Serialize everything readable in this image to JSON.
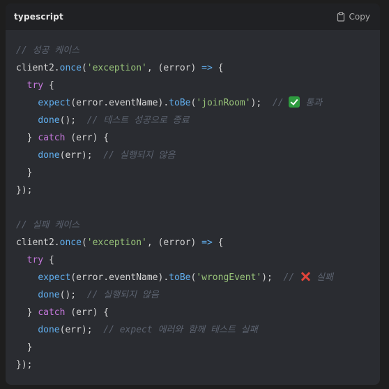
{
  "header": {
    "language": "typescript",
    "copy_label": "Copy",
    "copy_icon": "clipboard-icon"
  },
  "code": {
    "lines": [
      {
        "indent": "",
        "tokens": [
          [
            "cm",
            "// 성공 케이스"
          ]
        ]
      },
      {
        "indent": "",
        "tokens": [
          [
            "pl",
            "client2."
          ],
          [
            "fn",
            "once"
          ],
          [
            "pl",
            "("
          ],
          [
            "str",
            "'exception'"
          ],
          [
            "pl",
            ", (error) "
          ],
          [
            "fn",
            "=>"
          ],
          [
            "pl",
            " {"
          ]
        ]
      },
      {
        "indent": "  ",
        "tokens": [
          [
            "kw",
            "try"
          ],
          [
            "pl",
            " {"
          ]
        ]
      },
      {
        "indent": "    ",
        "tokens": [
          [
            "fn",
            "expect"
          ],
          [
            "pl",
            "(error.eventName)."
          ],
          [
            "fn",
            "toBe"
          ],
          [
            "pl",
            "("
          ],
          [
            "str",
            "'joinRoom'"
          ],
          [
            "pl",
            ");  "
          ],
          [
            "cm",
            "// "
          ],
          [
            "emoji",
            "check-mark-emoji"
          ],
          [
            "cm",
            " 통과"
          ]
        ]
      },
      {
        "indent": "    ",
        "tokens": [
          [
            "fn",
            "done"
          ],
          [
            "pl",
            "();  "
          ],
          [
            "cm",
            "// 테스트 성공으로 종료"
          ]
        ]
      },
      {
        "indent": "  ",
        "tokens": [
          [
            "pl",
            "} "
          ],
          [
            "kw",
            "catch"
          ],
          [
            "pl",
            " (err) {"
          ]
        ]
      },
      {
        "indent": "    ",
        "tokens": [
          [
            "fn",
            "done"
          ],
          [
            "pl",
            "(err);  "
          ],
          [
            "cm",
            "// 실행되지 않음"
          ]
        ]
      },
      {
        "indent": "  ",
        "tokens": [
          [
            "pl",
            "}"
          ]
        ]
      },
      {
        "indent": "",
        "tokens": [
          [
            "pl",
            "});"
          ]
        ]
      },
      {
        "indent": "",
        "tokens": []
      },
      {
        "indent": "",
        "tokens": [
          [
            "cm",
            "// 실패 케이스"
          ]
        ]
      },
      {
        "indent": "",
        "tokens": [
          [
            "pl",
            "client2."
          ],
          [
            "fn",
            "once"
          ],
          [
            "pl",
            "("
          ],
          [
            "str",
            "'exception'"
          ],
          [
            "pl",
            ", (error) "
          ],
          [
            "fn",
            "=>"
          ],
          [
            "pl",
            " {"
          ]
        ]
      },
      {
        "indent": "  ",
        "tokens": [
          [
            "kw",
            "try"
          ],
          [
            "pl",
            " {"
          ]
        ]
      },
      {
        "indent": "    ",
        "tokens": [
          [
            "fn",
            "expect"
          ],
          [
            "pl",
            "(error.eventName)."
          ],
          [
            "fn",
            "toBe"
          ],
          [
            "pl",
            "("
          ],
          [
            "str",
            "'wrongEvent'"
          ],
          [
            "pl",
            ");  "
          ],
          [
            "cm",
            "// "
          ],
          [
            "emoji",
            "cross-mark-emoji"
          ],
          [
            "cm",
            " 실패"
          ]
        ]
      },
      {
        "indent": "    ",
        "tokens": [
          [
            "fn",
            "done"
          ],
          [
            "pl",
            "();  "
          ],
          [
            "cm",
            "// 실행되지 않음"
          ]
        ]
      },
      {
        "indent": "  ",
        "tokens": [
          [
            "pl",
            "} "
          ],
          [
            "kw",
            "catch"
          ],
          [
            "pl",
            " (err) {"
          ]
        ]
      },
      {
        "indent": "    ",
        "tokens": [
          [
            "fn",
            "done"
          ],
          [
            "pl",
            "(err);  "
          ],
          [
            "cm",
            "// expect 에러와 함께 테스트 실패"
          ]
        ]
      },
      {
        "indent": "  ",
        "tokens": [
          [
            "pl",
            "}"
          ]
        ]
      },
      {
        "indent": "",
        "tokens": [
          [
            "pl",
            "});"
          ]
        ]
      }
    ]
  },
  "colors": {
    "comment": "#5c6370",
    "keyword": "#c678dd",
    "function": "#61afef",
    "string": "#98c379",
    "plain": "#d4d4d4",
    "background": "#2a2c31",
    "header_background": "#202124"
  }
}
